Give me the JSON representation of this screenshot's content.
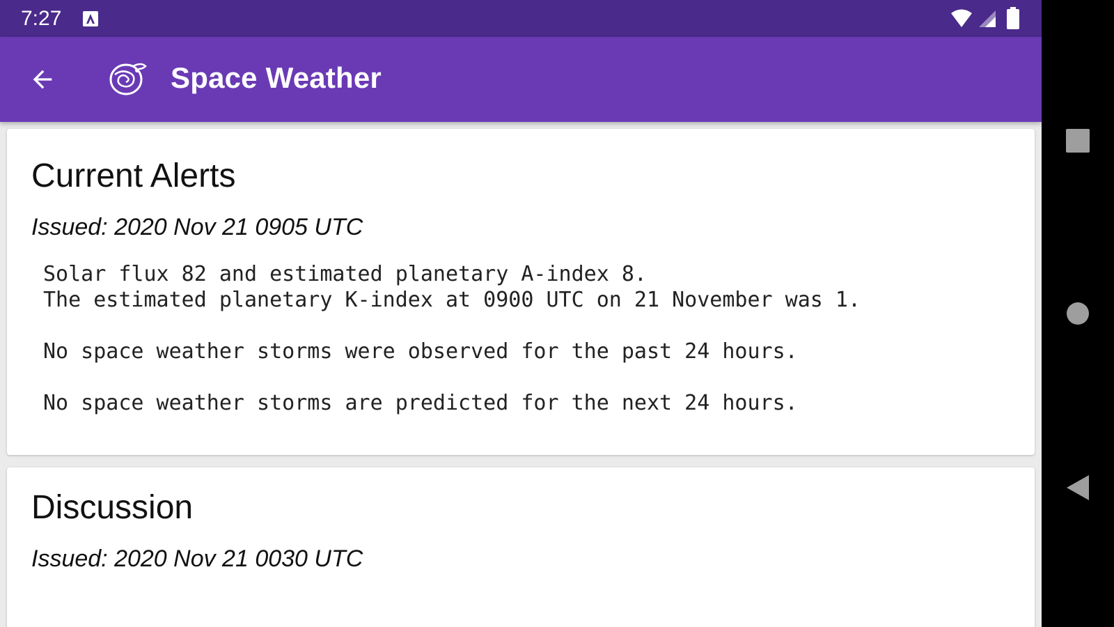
{
  "status_bar": {
    "time": "7:27",
    "notification_icon": "notification-a-icon",
    "wifi_icon": "wifi-icon",
    "signal_icon": "cell-signal-icon",
    "battery_icon": "battery-icon"
  },
  "app_bar": {
    "title": "Space Weather",
    "back_icon": "arrow-back-icon",
    "logo_icon": "space-weather-logo-icon",
    "background_color": "#6a3ab5",
    "status_color": "#4a2a8a"
  },
  "cards": [
    {
      "title": "Current Alerts",
      "issued": "Issued: 2020 Nov 21 0905 UTC",
      "body": "Solar flux 82 and estimated planetary A-index 8.\nThe estimated planetary K-index at 0900 UTC on 21 November was 1.\n\nNo space weather storms were observed for the past 24 hours.\n\nNo space weather storms are predicted for the next 24 hours."
    },
    {
      "title": "Discussion",
      "issued": "Issued: 2020 Nov 21 0030 UTC"
    }
  ],
  "nav_bar": {
    "recents_icon": "square-recents-icon",
    "home_icon": "circle-home-icon",
    "back_icon": "triangle-back-icon"
  }
}
